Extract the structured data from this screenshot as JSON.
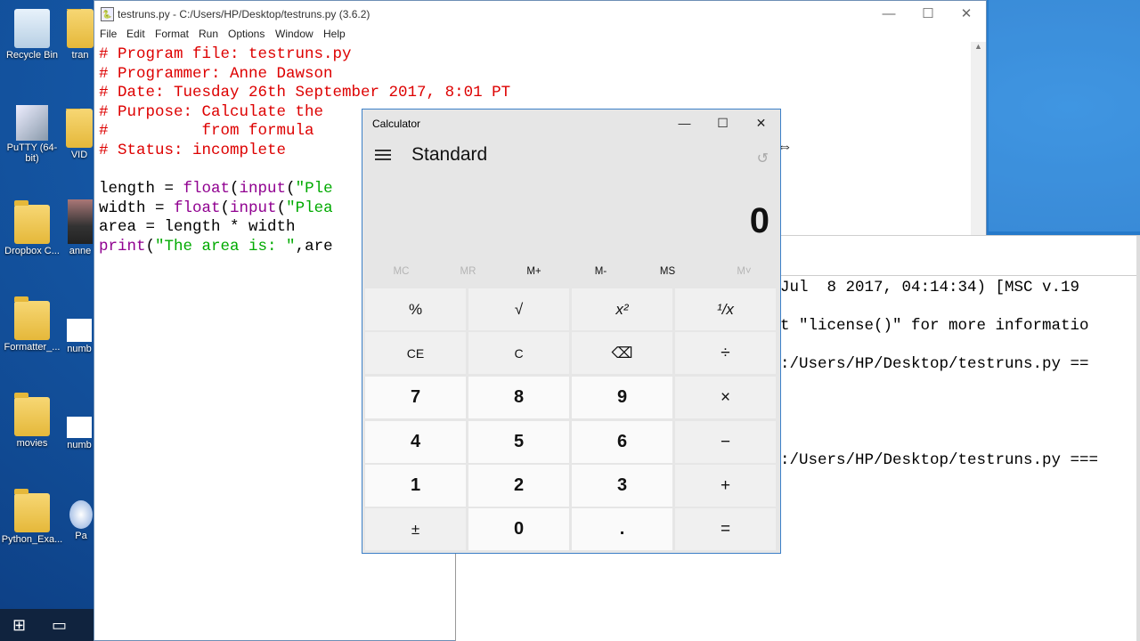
{
  "desktop": {
    "icons": [
      {
        "label": "Recycle Bin",
        "icon": "recycle-bin-icon"
      },
      {
        "label": "tran",
        "icon": "chrome-icon"
      },
      {
        "label": "PuTTY (64-bit)",
        "icon": "putty-icon"
      },
      {
        "label": "VID",
        "icon": "folder-icon"
      },
      {
        "label": "Dropbox C...",
        "icon": "dropbox-icon"
      },
      {
        "label": "anne",
        "icon": "photo-icon"
      },
      {
        "label": "Formatter_...",
        "icon": "folder-icon"
      },
      {
        "label": "numb",
        "icon": "file-icon"
      },
      {
        "label": "movies",
        "icon": "folder-icon"
      },
      {
        "label": "numb",
        "icon": "file-icon"
      },
      {
        "label": "Python_Exa...",
        "icon": "folder-icon"
      },
      {
        "label": "Pa",
        "icon": "paint-icon"
      }
    ]
  },
  "taskbar": {
    "start_icon": "windows-start-icon",
    "taskview_icon": "task-view-icon"
  },
  "idle": {
    "title": "testruns.py - C:/Users/HP/Desktop/testruns.py (3.6.2)",
    "menu": [
      "File",
      "Edit",
      "Format",
      "Run",
      "Options",
      "Window",
      "Help"
    ],
    "code": {
      "l1": "# Program file: testruns.py",
      "l2": "# Programmer: Anne Dawson",
      "l3": "# Date: Tuesday 26th September 2017, 8:01 PT",
      "l4": "# Purpose: Calculate the",
      "l4b": "f      t   l",
      "l5": "#          from formula",
      "l6": "# Status: incomplete",
      "l7a": "length = ",
      "l7b": "float",
      "l7c": "(",
      "l7d": "input",
      "l7e": "(",
      "l7f": "\"Ple",
      "l8a": "width = ",
      "l8b": "float",
      "l8c": "(",
      "l8d": "input",
      "l8e": "(",
      "l8f": "\"Plea",
      "l9": "area = length * width",
      "l10a": "print",
      "l10b": "(",
      "l10c": "\"The area is: \"",
      "l10d": ",are"
    }
  },
  "shell": {
    "lines": [
      "Jul  8 2017, 04:14:34) [MSC v.19",
      "",
      "t \"license()\" for more informatio",
      "",
      ":/Users/HP/Desktop/testruns.py ==",
      "",
      "",
      "",
      "",
      ":/Users/HP/Desktop/testruns.py ==="
    ]
  },
  "calculator": {
    "title": "Calculator",
    "mode": "Standard",
    "display": "0",
    "memory": [
      "MC",
      "MR",
      "M+",
      "M-",
      "MS",
      "M˅"
    ],
    "keys": [
      [
        "%",
        "√",
        "x²",
        "¹/x"
      ],
      [
        "CE",
        "C",
        "⌫",
        "÷"
      ],
      [
        "7",
        "8",
        "9",
        "×"
      ],
      [
        "4",
        "5",
        "6",
        "−"
      ],
      [
        "1",
        "2",
        "3",
        "+"
      ],
      [
        "±",
        "0",
        ".",
        "="
      ]
    ]
  }
}
